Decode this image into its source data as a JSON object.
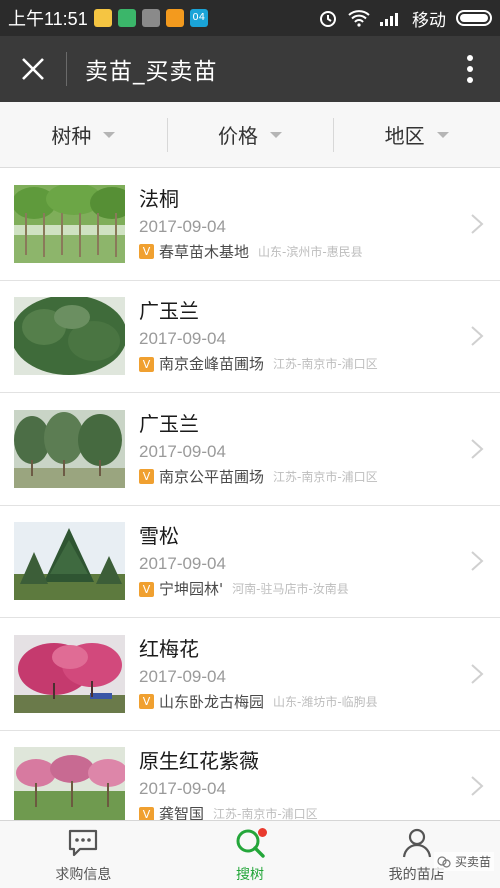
{
  "status_bar": {
    "time": "上午11:51",
    "notif_badge": "04",
    "carrier": "移动"
  },
  "header": {
    "title": "卖苗_买卖苗"
  },
  "filters": [
    {
      "label": "树种"
    },
    {
      "label": "价格"
    },
    {
      "label": "地区"
    }
  ],
  "listings": [
    {
      "title": "法桐",
      "date": "2017-09-04",
      "verified": "V",
      "source": "春草苗木基地",
      "location": "山东-滨州市-惠民县"
    },
    {
      "title": "广玉兰",
      "date": "2017-09-04",
      "verified": "V",
      "source": "南京金峰苗圃场",
      "location": "江苏-南京市-浦口区"
    },
    {
      "title": "广玉兰",
      "date": "2017-09-04",
      "verified": "V",
      "source": "南京公平苗圃场",
      "location": "江苏-南京市-浦口区"
    },
    {
      "title": "雪松",
      "date": "2017-09-04",
      "verified": "V",
      "source": "宁坤园林'",
      "location": "河南-驻马店市-汝南县"
    },
    {
      "title": "红梅花",
      "date": "2017-09-04",
      "verified": "V",
      "source": "山东卧龙古梅园",
      "location": "山东-潍坊市-临朐县"
    },
    {
      "title": "原生红花紫薇",
      "date": "2017-09-04",
      "verified": "V",
      "source": "龚智国",
      "location": "江苏-南京市-浦口区"
    }
  ],
  "tabs": [
    {
      "label": "求购信息"
    },
    {
      "label": "搜树"
    },
    {
      "label": "我的苗店"
    }
  ],
  "watermark": "买卖苗",
  "colors": {
    "header_bg": "#3a3a3a",
    "active_tab": "#24a63a",
    "verified_badge": "#f0a030"
  }
}
